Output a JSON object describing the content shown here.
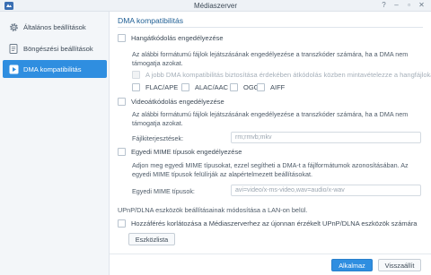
{
  "window": {
    "title": "Médiaszerver"
  },
  "sidebar": {
    "items": [
      {
        "label": "Általános beállítások",
        "icon": "gear-icon"
      },
      {
        "label": "Böngészési beállítások",
        "icon": "document-icon"
      },
      {
        "label": "DMA kompatibilitás",
        "icon": "play-icon"
      }
    ],
    "active_index": 2
  },
  "main": {
    "title": "DMA kompatibilitás",
    "audio_transcode": {
      "label": "Hangátkódolás engedélyezése",
      "description": "Az alábbi formátumú fájlok lejátszásának engedélyezése a transzkóder számára, ha a DMA nem támogatja azokat.",
      "best_compat_label": "A jobb DMA kompatibilitás biztosítása érdekében átkódolás közben mintavételezze a hangfájlokat",
      "formats": [
        "FLAC/APE",
        "ALAC/AAC",
        "OGG",
        "AIFF"
      ]
    },
    "video_transcode": {
      "label": "Videoátkódolás engedélyezése",
      "description": "Az alábbi formátumú fájlok lejátszásának engedélyezése a transzkóder számára, ha a DMA nem támogatja azokat.",
      "extensions_label": "Fájlkiterjesztések:",
      "extensions_placeholder": "rm;rmvb;mkv"
    },
    "custom_mime": {
      "label": "Egyedi MIME típusok engedélyezése",
      "description": "Adjon meg egyedi MIME típusokat, ezzel segítheti a DMA-t a fájlformátumok azonosításában. Az egyedi MIME típusok felülírják az alapértelmezett beállításokat.",
      "field_label": "Egyedi MIME típusok:",
      "field_placeholder": "avi=video/x-ms-video,wav=audio/x-wav"
    },
    "upnp": {
      "section_text": "UPnP/DLNA eszközök beállításainak módosítása a LAN-on belül.",
      "restrict_label": "Hozzáférés korlátozása a Médiaszerverhez az újonnan érzékelt UPnP/DLNA eszközök számára",
      "device_list_button": "Eszközlista"
    }
  },
  "footer": {
    "apply": "Alkalmaz",
    "reset": "Visszaállít"
  },
  "colors": {
    "accent": "#2f8ee0",
    "heading": "#1f5f95"
  }
}
